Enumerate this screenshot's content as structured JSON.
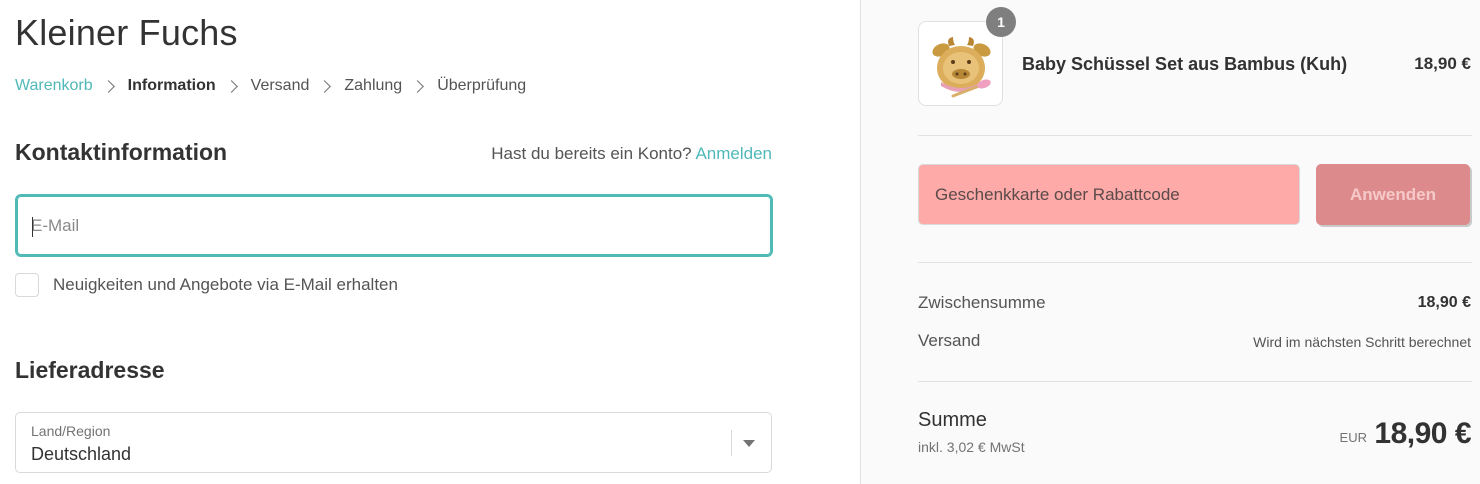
{
  "shop": {
    "title": "Kleiner Fuchs"
  },
  "breadcrumb": {
    "items": [
      {
        "label": "Warenkorb",
        "state": "link"
      },
      {
        "label": "Information",
        "state": "current"
      },
      {
        "label": "Versand",
        "state": "upcoming"
      },
      {
        "label": "Zahlung",
        "state": "upcoming"
      },
      {
        "label": "Überprüfung",
        "state": "upcoming"
      }
    ]
  },
  "contact": {
    "title": "Kontaktinformation",
    "login_prompt": "Hast du bereits ein Konto?",
    "login_link": "Anmelden",
    "email_placeholder": "E-Mail",
    "email_value": "",
    "newsletter_label": "Neuigkeiten und Angebote via E-Mail erhalten",
    "newsletter_checked": false
  },
  "delivery": {
    "title": "Lieferadresse",
    "country_label": "Land/Region",
    "country_value": "Deutschland"
  },
  "summary": {
    "product": {
      "name": "Baby Schüssel Set aus Bambus (Kuh)",
      "price": "18,90 €",
      "quantity": "1",
      "image_icon": "bamboo-bowl-cow-image"
    },
    "discount": {
      "placeholder": "Geschenkkarte oder Rabattcode",
      "button_label": "Anwenden"
    },
    "subtotal_label": "Zwischensumme",
    "subtotal_value": "18,90 €",
    "shipping_label": "Versand",
    "shipping_value": "Wird im nächsten Schritt berechnet",
    "total_label": "Summe",
    "tax_note": "inkl. 3,02 € MwSt",
    "currency": "EUR",
    "total_value": "18,90 €"
  },
  "colors": {
    "accent": "#4fb8b8",
    "discount_highlight": "#fdaaa8",
    "apply_button": "#dd8a8c",
    "summary_background": "#fafafa"
  }
}
